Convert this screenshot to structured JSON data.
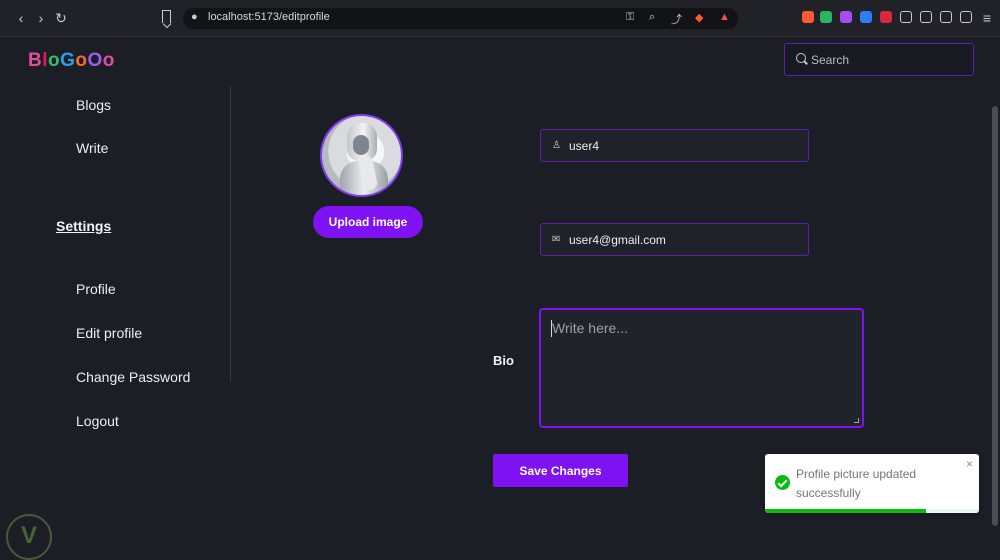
{
  "browser": {
    "url": "localhost:5173/editprofile"
  },
  "app": {
    "logo": "BloGoOo",
    "logo_colors": [
      "#e24e9f",
      "#e11d4f",
      "#34bf64",
      "#2f9df3",
      "#f16c2f",
      "#9d5cf5"
    ],
    "search_placeholder": "Search"
  },
  "sidebar": {
    "items": [
      {
        "label": "Blogs"
      },
      {
        "label": "Write"
      },
      {
        "label": "Settings"
      },
      {
        "label": "Profile"
      },
      {
        "label": "Edit profile"
      },
      {
        "label": "Change Password"
      },
      {
        "label": "Logout"
      }
    ]
  },
  "profile": {
    "upload_button": "Upload image",
    "username": "user4",
    "email": "user4@gmail.com",
    "bio_label": "Bio",
    "bio_placeholder": "Write here...",
    "save_button": "Save Changes"
  },
  "toast": {
    "message": "Profile picture updated successfully",
    "close": "×",
    "progress": 0.75
  },
  "colors": {
    "accent": "#7f12f2",
    "border": "#5b1fb0",
    "success": "#07bc0c"
  }
}
